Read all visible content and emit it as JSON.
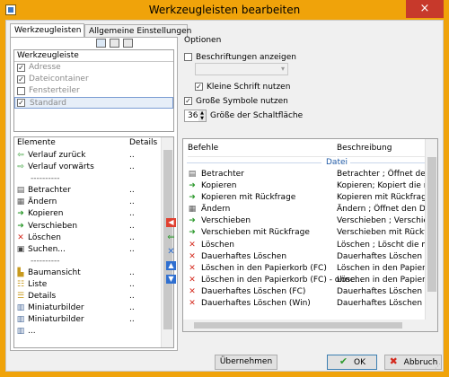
{
  "window": {
    "title": "Werkzeugleisten bearbeiten",
    "close_glyph": "×"
  },
  "tabs": [
    {
      "label": "Werkzeugleisten"
    },
    {
      "label": "Allgemeine Einstellungen"
    }
  ],
  "toolbar_icons": [
    "new-toolbar-icon",
    "rename-toolbar-icon",
    "delete-toolbar-icon"
  ],
  "toolbars": {
    "header": "Werkzeugleiste",
    "items": [
      {
        "label": "Adresse",
        "checked": true
      },
      {
        "label": "Dateicontainer",
        "checked": true
      },
      {
        "label": "Fensterteiler",
        "checked": false
      },
      {
        "label": "Standard",
        "checked": true,
        "selected": true
      }
    ]
  },
  "elements": {
    "col_elements": "Elemente",
    "col_details": "Details",
    "rows": [
      {
        "label": "Verlauf zurück",
        "details": "..",
        "icon": "arrow-left-icon"
      },
      {
        "label": "Verlauf vorwärts",
        "details": "..",
        "icon": "arrow-right-icon"
      },
      {
        "label": "----------",
        "details": "",
        "icon": ""
      },
      {
        "label": "Betrachter",
        "details": "..",
        "icon": "viewer-icon"
      },
      {
        "label": "Ändern",
        "details": "..",
        "icon": "edit-icon"
      },
      {
        "label": "Kopieren",
        "details": "..",
        "icon": "copy-icon"
      },
      {
        "label": "Verschieben",
        "details": "..",
        "icon": "move-icon"
      },
      {
        "label": "Löschen",
        "details": "..",
        "icon": "delete-icon"
      },
      {
        "label": "Suchen...",
        "details": "..",
        "icon": "search-icon"
      },
      {
        "label": "----------",
        "details": "",
        "icon": ""
      },
      {
        "label": "Baumansicht",
        "details": "..",
        "icon": "tree-icon"
      },
      {
        "label": "Liste",
        "details": "..",
        "icon": "list-icon"
      },
      {
        "label": "Details",
        "details": "..",
        "icon": "details-icon"
      },
      {
        "label": "Miniaturbilder",
        "details": "..",
        "icon": "thumbnails-icon"
      },
      {
        "label": "Miniaturbilder",
        "details": "..",
        "icon": "thumbnails-icon"
      },
      {
        "label": "...",
        "details": "",
        "icon": "thumbnails-icon"
      }
    ]
  },
  "middle_buttons": [
    "remove-icon",
    "insert-icon",
    "delete-x-icon",
    "move-up-icon",
    "move-down-icon"
  ],
  "options": {
    "label": "Optionen",
    "show_labels": {
      "label": "Beschriftungen anzeigen",
      "checked": false
    },
    "small_font": {
      "label": "Kleine Schrift nutzen",
      "checked": true
    },
    "large_icons": {
      "label": "Große Symbole nutzen",
      "checked": true
    },
    "button_size": {
      "value": "36",
      "label": "Größe der Schaltfläche"
    }
  },
  "commands": {
    "col_commands": "Befehle",
    "col_description": "Beschreibung",
    "group": "Datei",
    "rows": [
      {
        "name": "Betrachter",
        "desc": "Betrachter ; Öffnet den intern",
        "icon": "viewer-icon"
      },
      {
        "name": "Kopieren",
        "desc": "Kopieren; Kopiert die markier",
        "icon": "copy-icon"
      },
      {
        "name": "Kopieren mit Rückfrage",
        "desc": "Kopieren mit Rückfrage; Kop",
        "icon": "copy-icon"
      },
      {
        "name": "Ändern",
        "desc": "Ändern ; Öffnet den Dateiedi",
        "icon": "edit-icon"
      },
      {
        "name": "Verschieben",
        "desc": "Verschieben ; Verschiebt die a",
        "icon": "move-icon"
      },
      {
        "name": "Verschieben mit Rückfrage",
        "desc": "Verschieben mit Rückfrage; V",
        "icon": "move-icon"
      },
      {
        "name": "Löschen",
        "desc": "Löschen ; Löscht die markier",
        "icon": "delete-icon"
      },
      {
        "name": "Dauerhaftes Löschen",
        "desc": "Dauerhaftes Löschen",
        "icon": "delete-icon"
      },
      {
        "name": "Löschen in den Papierkorb (FC)",
        "desc": "Löschen in den Papierkorb (F",
        "icon": "delete-icon"
      },
      {
        "name": "Löschen in den Papierkorb (FC) - ohne...",
        "desc": "Löschen in den Papierkorb (F",
        "icon": "delete-icon"
      },
      {
        "name": "Dauerhaftes Löschen (FC)",
        "desc": "Dauerhaftes Löschen (FC)",
        "icon": "delete-icon"
      },
      {
        "name": "Dauerhaftes Löschen (Win)",
        "desc": "Dauerhaftes Löschen (Win)",
        "icon": "delete-icon"
      }
    ]
  },
  "footer": {
    "apply": "Übernehmen",
    "ok": "OK",
    "cancel": "Abbruch"
  }
}
